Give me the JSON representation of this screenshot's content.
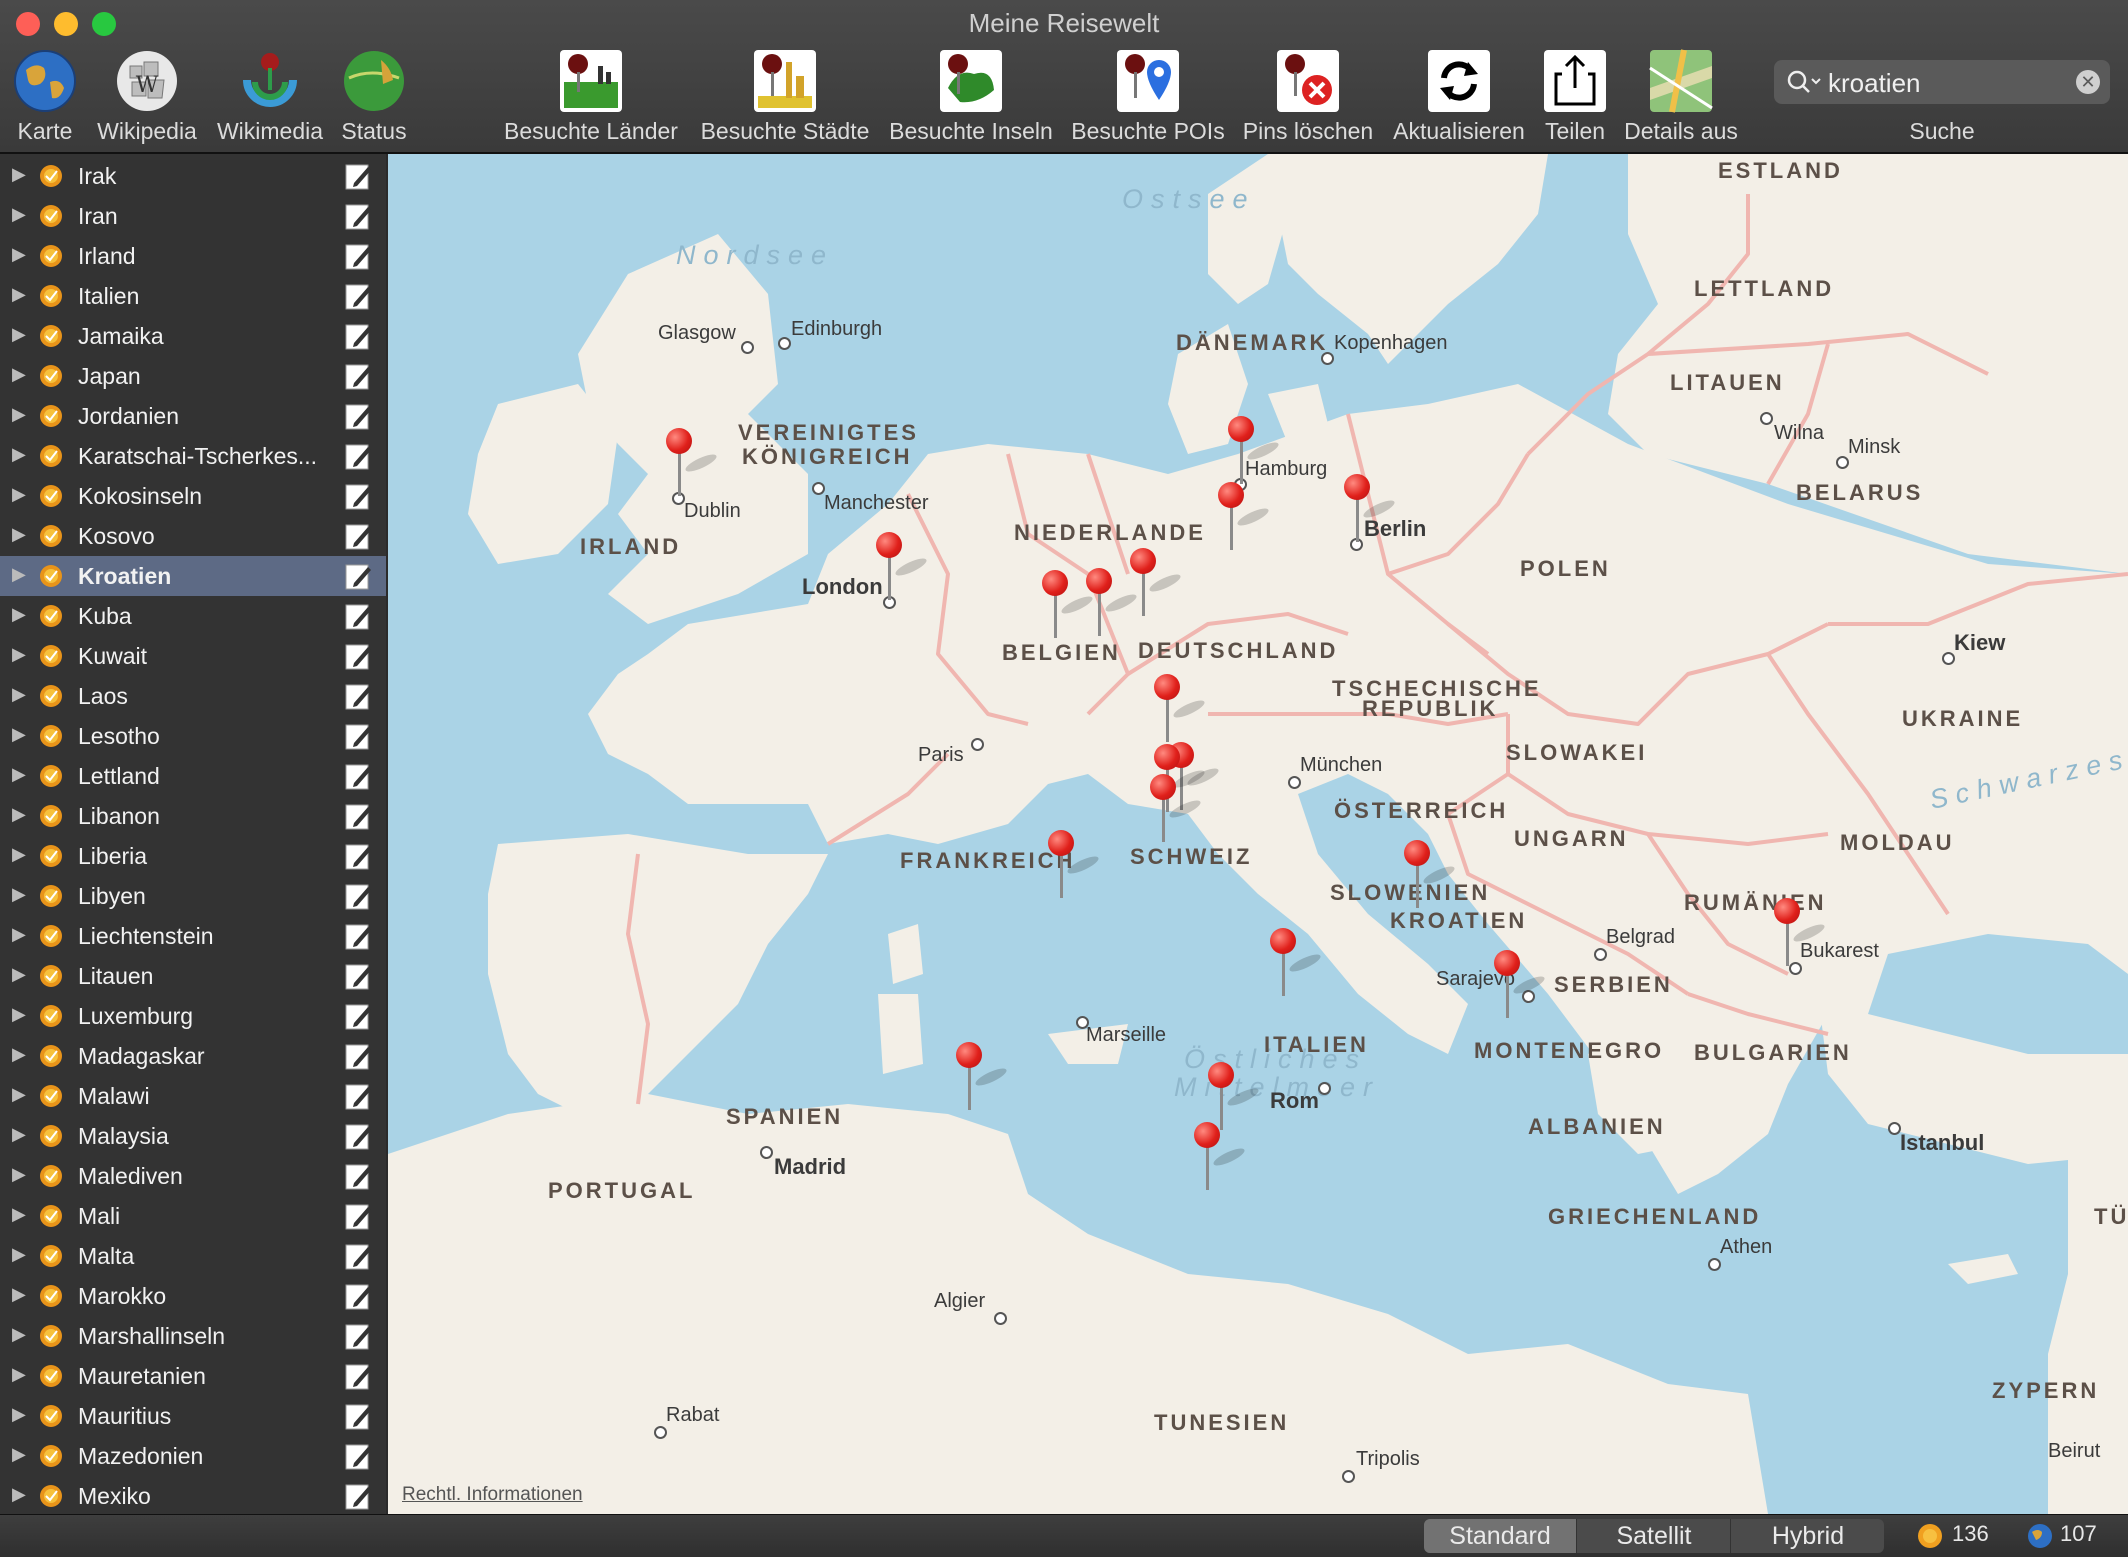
{
  "window": {
    "title": "Meine Reisewelt"
  },
  "toolbar": {
    "left": [
      {
        "label": "Karte",
        "icon": "globe-icon"
      },
      {
        "label": "Wikipedia",
        "icon": "wikipedia-icon"
      },
      {
        "label": "Wikimedia",
        "icon": "wikimedia-icon"
      },
      {
        "label": "Status",
        "icon": "status-globe-icon"
      }
    ],
    "center": [
      {
        "label": "Besuchte Länder",
        "icon": "visited-countries-icon"
      },
      {
        "label": "Besuchte Städte",
        "icon": "visited-cities-icon"
      },
      {
        "label": "Besuchte Inseln",
        "icon": "visited-islands-icon"
      },
      {
        "label": "Besuchte POIs",
        "icon": "visited-pois-icon"
      },
      {
        "label": "Pins löschen",
        "icon": "delete-pins-icon"
      },
      {
        "label": "Aktualisieren",
        "icon": "refresh-icon"
      },
      {
        "label": "Teilen",
        "icon": "share-icon"
      },
      {
        "label": "Details aus",
        "icon": "details-map-icon"
      }
    ],
    "search": {
      "value": "kroatien",
      "label": "Suche"
    }
  },
  "sidebar": {
    "items": [
      "Irak",
      "Iran",
      "Irland",
      "Italien",
      "Jamaika",
      "Japan",
      "Jordanien",
      "Karatschai-Tscherkes...",
      "Kokosinseln",
      "Kosovo",
      "Kroatien",
      "Kuba",
      "Kuwait",
      "Laos",
      "Lesotho",
      "Lettland",
      "Libanon",
      "Liberia",
      "Libyen",
      "Liechtenstein",
      "Litauen",
      "Luxemburg",
      "Madagaskar",
      "Malawi",
      "Malaysia",
      "Malediven",
      "Mali",
      "Malta",
      "Marokko",
      "Marshallinseln",
      "Mauretanien",
      "Mauritius",
      "Mazedonien",
      "Mexiko"
    ],
    "selected": "Kroatien"
  },
  "map": {
    "legal": "Rechtl. Informationen",
    "countries": [
      "ESTLAND",
      "LETTLAND",
      "LITAUEN",
      "BELARUS",
      "DÄNEMARK",
      "VEREINIGTES",
      "KÖNIGREICH",
      "IRLAND",
      "NIEDERLANDE",
      "POLEN",
      "BELGIEN",
      "DEUTSCHLAND",
      "TSCHECHISCHE",
      "REPUBLIK",
      "UKRAINE",
      "SLOWAKEI",
      "ÖSTERREICH",
      "UNGARN",
      "MOLDAU",
      "FRANKREICH",
      "SCHWEIZ",
      "SLOWENIEN",
      "KROATIEN",
      "RUMÄNIEN",
      "SERBIEN",
      "ITALIEN",
      "MONTENEGRO",
      "BULGARIEN",
      "SPANIEN",
      "ALBANIEN",
      "PORTUGAL",
      "GRIECHENLAND",
      "TÜRK",
      "ZYPERN",
      "TUNESIEN"
    ],
    "cities": [
      "Glasgow",
      "Edinburgh",
      "Kopenhagen",
      "Wilna",
      "Minsk",
      "Hamburg",
      "Dublin",
      "Manchester",
      "Berlin",
      "London",
      "Kiew",
      "Paris",
      "München",
      "Belgrad",
      "Bukarest",
      "Sarajevo",
      "Marseille",
      "Rom",
      "Madrid",
      "Istanbul",
      "Athen",
      "Algier",
      "Rabat",
      "Tripolis",
      "Beirut"
    ],
    "seas": [
      "Nordsee",
      "Ostsee",
      "Schwarzes",
      "Östliches",
      "Mittelmeer"
    ]
  },
  "bottom": {
    "map_types": [
      "Standard",
      "Satellit",
      "Hybrid"
    ],
    "active_map_type": "Standard",
    "countries_count": "136",
    "places_count": "107"
  }
}
